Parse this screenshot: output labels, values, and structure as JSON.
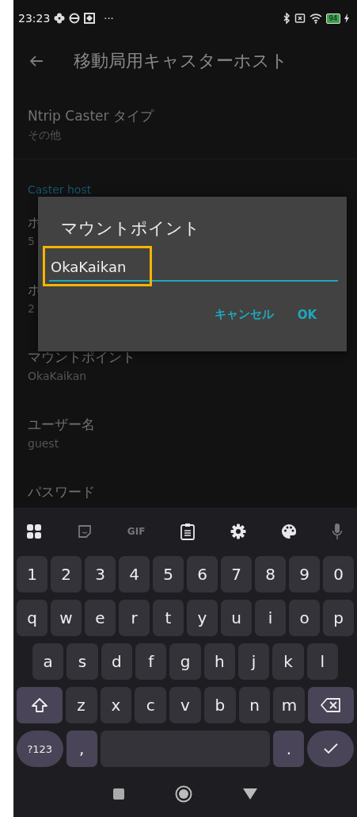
{
  "status_bar": {
    "time": "23:23",
    "more": "···",
    "battery": "94"
  },
  "app_bar": {
    "title": "移動局用キャスターホスト"
  },
  "settings": [
    {
      "kind": "item",
      "title": "Ntrip Caster タイプ",
      "value": "その他"
    },
    {
      "kind": "header",
      "title": "Caster host"
    },
    {
      "kind": "item",
      "title": "ホ",
      "value": "5"
    },
    {
      "kind": "item",
      "title": "ホ",
      "value": "2"
    },
    {
      "kind": "item",
      "title": "マウントポイント",
      "value": "OkaKaikan"
    },
    {
      "kind": "item",
      "title": "ユーザー名",
      "value": "guest"
    },
    {
      "kind": "item",
      "title": "パスワード"
    }
  ],
  "dialog": {
    "title": "マウントポイント",
    "value": "OkaKaikan",
    "highlighted": true,
    "buttons": [
      "キャンセル",
      "OK"
    ]
  },
  "keyboard": {
    "toolbar_gif": "GIF",
    "rows": [
      [
        {
          "kind": "key",
          "label": "1"
        },
        {
          "kind": "key",
          "label": "2"
        },
        {
          "kind": "key",
          "label": "3"
        },
        {
          "kind": "key",
          "label": "4"
        },
        {
          "kind": "key",
          "label": "5"
        },
        {
          "kind": "key",
          "label": "6"
        },
        {
          "kind": "key",
          "label": "7"
        },
        {
          "kind": "key",
          "label": "8"
        },
        {
          "kind": "key",
          "label": "9"
        },
        {
          "kind": "key",
          "label": "0"
        }
      ],
      [
        {
          "kind": "key",
          "label": "q"
        },
        {
          "kind": "key",
          "label": "w"
        },
        {
          "kind": "key",
          "label": "e"
        },
        {
          "kind": "key",
          "label": "r"
        },
        {
          "kind": "key",
          "label": "t"
        },
        {
          "kind": "key",
          "label": "y"
        },
        {
          "kind": "key",
          "label": "u"
        },
        {
          "kind": "key",
          "label": "i"
        },
        {
          "kind": "key",
          "label": "o"
        },
        {
          "kind": "key",
          "label": "p"
        }
      ],
      [
        {
          "kind": "key",
          "label": "a"
        },
        {
          "kind": "key",
          "label": "s"
        },
        {
          "kind": "key",
          "label": "d"
        },
        {
          "kind": "key",
          "label": "f"
        },
        {
          "kind": "key",
          "label": "g"
        },
        {
          "kind": "key",
          "label": "h"
        },
        {
          "kind": "key",
          "label": "j"
        },
        {
          "kind": "key",
          "label": "k"
        },
        {
          "kind": "key",
          "label": "l"
        }
      ],
      [
        {
          "kind": "shift"
        },
        {
          "kind": "key",
          "label": "z"
        },
        {
          "kind": "key",
          "label": "x"
        },
        {
          "kind": "key",
          "label": "c"
        },
        {
          "kind": "key",
          "label": "v"
        },
        {
          "kind": "key",
          "label": "b"
        },
        {
          "kind": "key",
          "label": "n"
        },
        {
          "kind": "key",
          "label": "m"
        },
        {
          "kind": "backspace"
        }
      ],
      [
        {
          "kind": "mode",
          "label": "?123"
        },
        {
          "kind": "punct",
          "label": ","
        },
        {
          "kind": "space"
        },
        {
          "kind": "punct",
          "label": "."
        },
        {
          "kind": "enter"
        }
      ]
    ]
  }
}
